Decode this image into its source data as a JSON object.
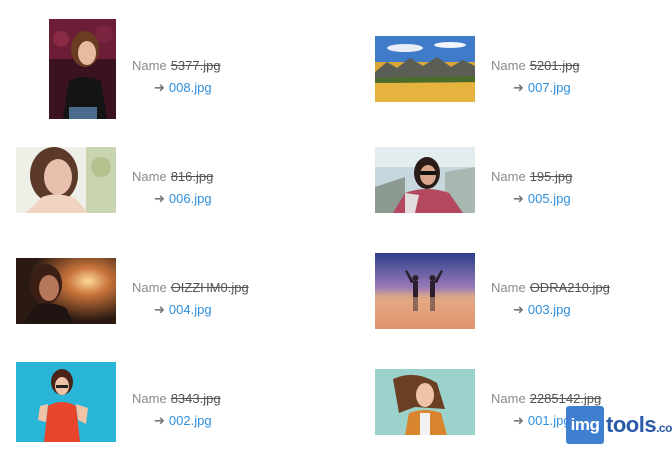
{
  "label_prefix": "Name",
  "arrow": "➜",
  "items": [
    {
      "old": "5377.jpg",
      "new": "008.jpg"
    },
    {
      "old": "5201.jpg",
      "new": "007.jpg"
    },
    {
      "old": "816.jpg",
      "new": "006.jpg"
    },
    {
      "old": "195.jpg",
      "new": "005.jpg"
    },
    {
      "old": "OIZZHM0.jpg",
      "new": "004.jpg"
    },
    {
      "old": "ODRA210.jpg",
      "new": "003.jpg"
    },
    {
      "old": "8343.jpg",
      "new": "002.jpg"
    },
    {
      "old": "2285142.jpg",
      "new": "001.jpg"
    }
  ],
  "logo": {
    "box": "img",
    "rest": "tools",
    "suffix": ".co"
  }
}
